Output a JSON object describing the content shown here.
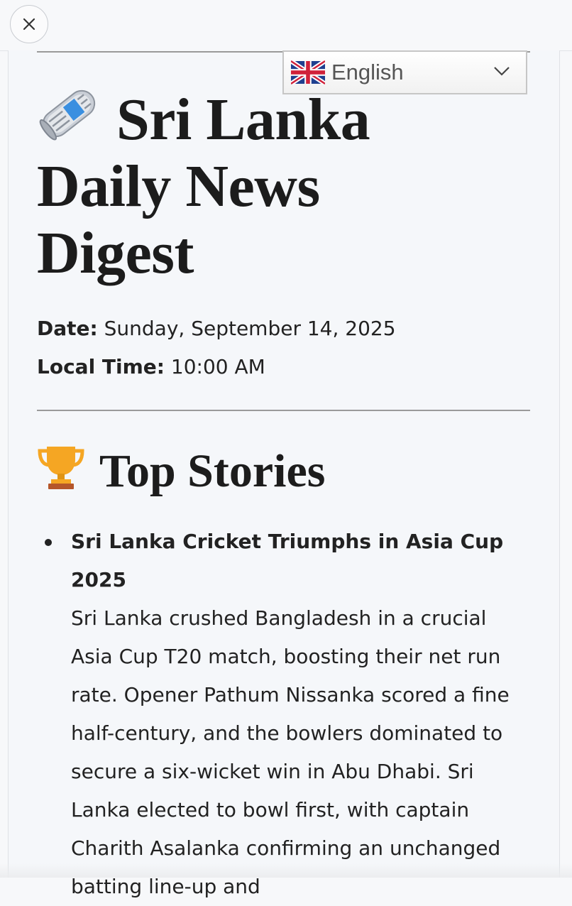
{
  "toolbar": {
    "close_icon": "close-icon"
  },
  "language_selector": {
    "selected": "English",
    "flag_icon": "uk-flag-icon"
  },
  "header": {
    "icon": "rolled-newspaper-icon",
    "title": "Sri Lanka Daily News Digest"
  },
  "meta": {
    "date_label": "Date:",
    "date_value": "Sunday, September 14, 2025",
    "time_label": "Local Time:",
    "time_value": "10:00 AM"
  },
  "top_stories": {
    "icon": "trophy-icon",
    "heading": "Top Stories",
    "items": [
      {
        "title": "Sri Lanka Cricket Triumphs in Asia Cup 2025",
        "body": "Sri Lanka crushed Bangladesh in a crucial Asia Cup T20 match, boosting their net run rate. Opener Pathum Nissanka scored a fine half-century, and the bowlers dominated to secure a six-wicket win in Abu Dhabi. Sri Lanka elected to bowl first, with captain Charith Asalanka confirming an unchanged batting line-up and"
      }
    ]
  },
  "colors": {
    "background": "#f5f7fa",
    "text": "#1c1c1c",
    "rule": "#9a9a9a"
  }
}
